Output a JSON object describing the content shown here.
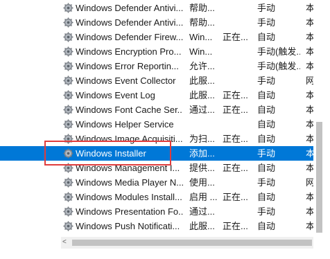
{
  "services": [
    {
      "name": "Windows Defender Antivi...",
      "description": "帮助...",
      "status": "",
      "startup": "手动",
      "logon": "本"
    },
    {
      "name": "Windows Defender Antivi...",
      "description": "帮助...",
      "status": "",
      "startup": "手动",
      "logon": "本"
    },
    {
      "name": "Windows Defender Firew...",
      "description": "Win...",
      "status": "正在...",
      "startup": "自动",
      "logon": "本"
    },
    {
      "name": "Windows Encryption Pro...",
      "description": "Win...",
      "status": "",
      "startup": "手动(触发...",
      "logon": "本"
    },
    {
      "name": "Windows Error Reportin...",
      "description": "允许...",
      "status": "",
      "startup": "手动(触发...",
      "logon": "本"
    },
    {
      "name": "Windows Event Collector",
      "description": "此服...",
      "status": "",
      "startup": "手动",
      "logon": "网"
    },
    {
      "name": "Windows Event Log",
      "description": "此服...",
      "status": "正在...",
      "startup": "自动",
      "logon": "本"
    },
    {
      "name": "Windows Font Cache Ser...",
      "description": "通过...",
      "status": "正在...",
      "startup": "自动",
      "logon": "本"
    },
    {
      "name": "Windows Helper Service",
      "description": "",
      "status": "",
      "startup": "自动",
      "logon": "本"
    },
    {
      "name": "Windows Image Acquisiti...",
      "description": "为扫...",
      "status": "正在...",
      "startup": "自动",
      "logon": "本"
    },
    {
      "name": "Windows Installer",
      "description": "添加...",
      "status": "",
      "startup": "手动",
      "logon": "本",
      "selected": true
    },
    {
      "name": "Windows Management I...",
      "description": "提供...",
      "status": "正在...",
      "startup": "自动",
      "logon": "本"
    },
    {
      "name": "Windows Media Player N...",
      "description": "使用...",
      "status": "",
      "startup": "手动",
      "logon": "网"
    },
    {
      "name": "Windows Modules Install...",
      "description": "启用 ...",
      "status": "正在...",
      "startup": "自动",
      "logon": "本"
    },
    {
      "name": "Windows Presentation Fo...",
      "description": "通过...",
      "status": "",
      "startup": "手动",
      "logon": "本"
    },
    {
      "name": "Windows Push Notificati...",
      "description": "此服...",
      "status": "正在...",
      "startup": "自动",
      "logon": "本"
    }
  ],
  "icon": "gear-icon",
  "selection_color": "#0078d7",
  "highlight_color": "#e03c3c",
  "scroll_left_arrow": "<"
}
